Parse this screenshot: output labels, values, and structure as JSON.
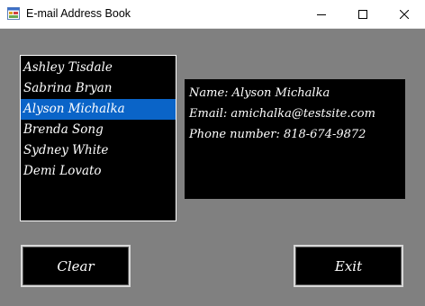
{
  "window": {
    "title": "E-mail Address Book",
    "controls": {
      "minimize_icon": "minimize-icon",
      "maximize_icon": "maximize-icon",
      "close_icon": "close-icon"
    }
  },
  "contacts": {
    "items": [
      {
        "label": "Ashley Tisdale"
      },
      {
        "label": "Sabrina Bryan"
      },
      {
        "label": "Alyson Michalka"
      },
      {
        "label": "Brenda Song"
      },
      {
        "label": "Sydney White"
      },
      {
        "label": "Demi Lovato"
      }
    ],
    "selected_index": 2,
    "selection_color": "#0a64c8"
  },
  "details": {
    "name": "Name: Alyson Michalka",
    "email": "Email: amichalka@testsite.com",
    "phone": "Phone number: 818-674-9872"
  },
  "buttons": {
    "clear_label": "Clear",
    "exit_label": "Exit"
  },
  "colors": {
    "form_background": "#808080",
    "control_background": "#000000",
    "text": "#ffffff"
  }
}
